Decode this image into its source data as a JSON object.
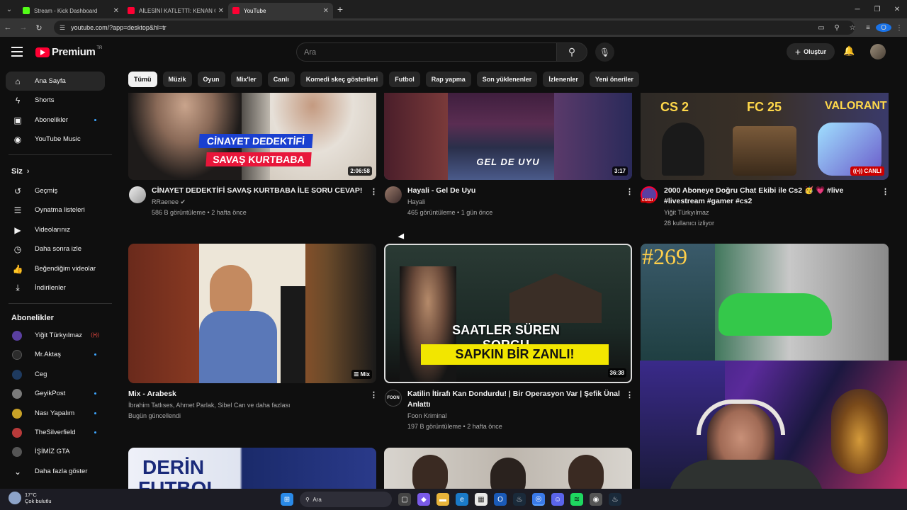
{
  "browser": {
    "tabs": [
      {
        "title": "Stream - Kick Dashboard",
        "favicon_color": "#53fc18"
      },
      {
        "title": "AİLESİNİ KATLETTİ: KENAN ÖN",
        "favicon_color": "#ff0033"
      },
      {
        "title": "YouTube",
        "favicon_color": "#ff0033"
      }
    ],
    "url": "youtube.com/?app=desktop&hl=tr",
    "profile_initial": "O"
  },
  "header": {
    "logo_text": "Premium",
    "region": "TR",
    "search_placeholder": "Ara",
    "create_label": "Oluştur"
  },
  "chips": [
    "Tümü",
    "Müzik",
    "Oyun",
    "Mix'ler",
    "Canlı",
    "Komedi skeç gösterileri",
    "Futbol",
    "Rap yapma",
    "Son yüklenenler",
    "İzlenenler",
    "Yeni öneriler"
  ],
  "sidebar": {
    "main": [
      {
        "label": "Ana Sayfa",
        "icon": "home-icon"
      },
      {
        "label": "Shorts",
        "icon": "shorts-icon"
      },
      {
        "label": "Abonelikler",
        "icon": "subscriptions-icon"
      },
      {
        "label": "YouTube Music",
        "icon": "music-icon"
      }
    ],
    "you_label": "Siz",
    "you": [
      {
        "label": "Geçmiş",
        "icon": "history-icon"
      },
      {
        "label": "Oynatma listeleri",
        "icon": "playlist-icon"
      },
      {
        "label": "Videolarınız",
        "icon": "your-videos-icon"
      },
      {
        "label": "Daha sonra izle",
        "icon": "watch-later-icon"
      },
      {
        "label": "Beğendiğim videolar",
        "icon": "like-icon"
      },
      {
        "label": "İndirilenler",
        "icon": "download-icon"
      }
    ],
    "subs_label": "Abonelikler",
    "subs": [
      {
        "label": "Yiğit Türkyılmaz",
        "color": "#5a3fa0"
      },
      {
        "label": "Mr.Aktaş",
        "color": "#2c2c2c"
      },
      {
        "label": "Ceg",
        "color": "#1e3a5f"
      },
      {
        "label": "GeyikPost",
        "color": "#7a7a7a"
      },
      {
        "label": "Nası Yapalım",
        "color": "#c9a227"
      },
      {
        "label": "TheSilverfield",
        "color": "#b83a3a"
      },
      {
        "label": "İŞİMİZ GTA",
        "color": "#555555"
      }
    ],
    "more_label": "Daha fazla göster"
  },
  "videos": [
    {
      "title": "CİNAYET DEDEKTİFİ SAVAŞ KURTBABA İLE SORU CEVAP!",
      "channel": "RRaenee",
      "meta": "586 B görüntüleme • 2 hafta önce",
      "duration": "2:06:58",
      "overlay1": "CİNAYET DEDEKTİFİ",
      "overlay2": "SAVAŞ KURTBABA"
    },
    {
      "title": "Hayali - Gel De Uyu",
      "channel": "Hayali",
      "meta": "465 görüntüleme • 1 gün önce",
      "duration": "3:17",
      "overlay1": "GEL DE UYU"
    },
    {
      "title": "2000 Aboneye Doğru Chat Ekibi ile Cs2 🥳 💗 #live #livestream #gamer #cs2",
      "channel": "Yiğit Türkyılmaz",
      "meta": "28 kullanıcı izliyor",
      "badge": "CANLI",
      "channel_badge": "CANLI",
      "tags": [
        "CS 2",
        "FC 25",
        "VALORANT"
      ]
    },
    {
      "title": "Mix - Arabesk",
      "channel": "İbrahim Tatlıses, Ahmet Parlak, Sibel Can ve daha fazlası",
      "meta": "Bugün güncellendi",
      "duration": "Mix"
    },
    {
      "title": "Katilin İtirafı Kan Dondurdu! | Bir Operasyon Var | Şefik Ünal Anlattı",
      "channel": "Foon Kriminal",
      "meta": "197 B görüntüleme • 2 hafta önce",
      "duration": "36:38",
      "overlay1": "SAATLER SÜREN SORGU",
      "overlay2": "SAPKIN BİR ZANLI!",
      "channel_badge": "FOON"
    },
    {
      "overlay1": "#269"
    },
    {
      "overlay1": "DERİN",
      "overlay2": "FUTBOL"
    }
  ],
  "taskbar": {
    "temp": "17°C",
    "weather": "Çok bulutlu",
    "search": "Ara"
  }
}
